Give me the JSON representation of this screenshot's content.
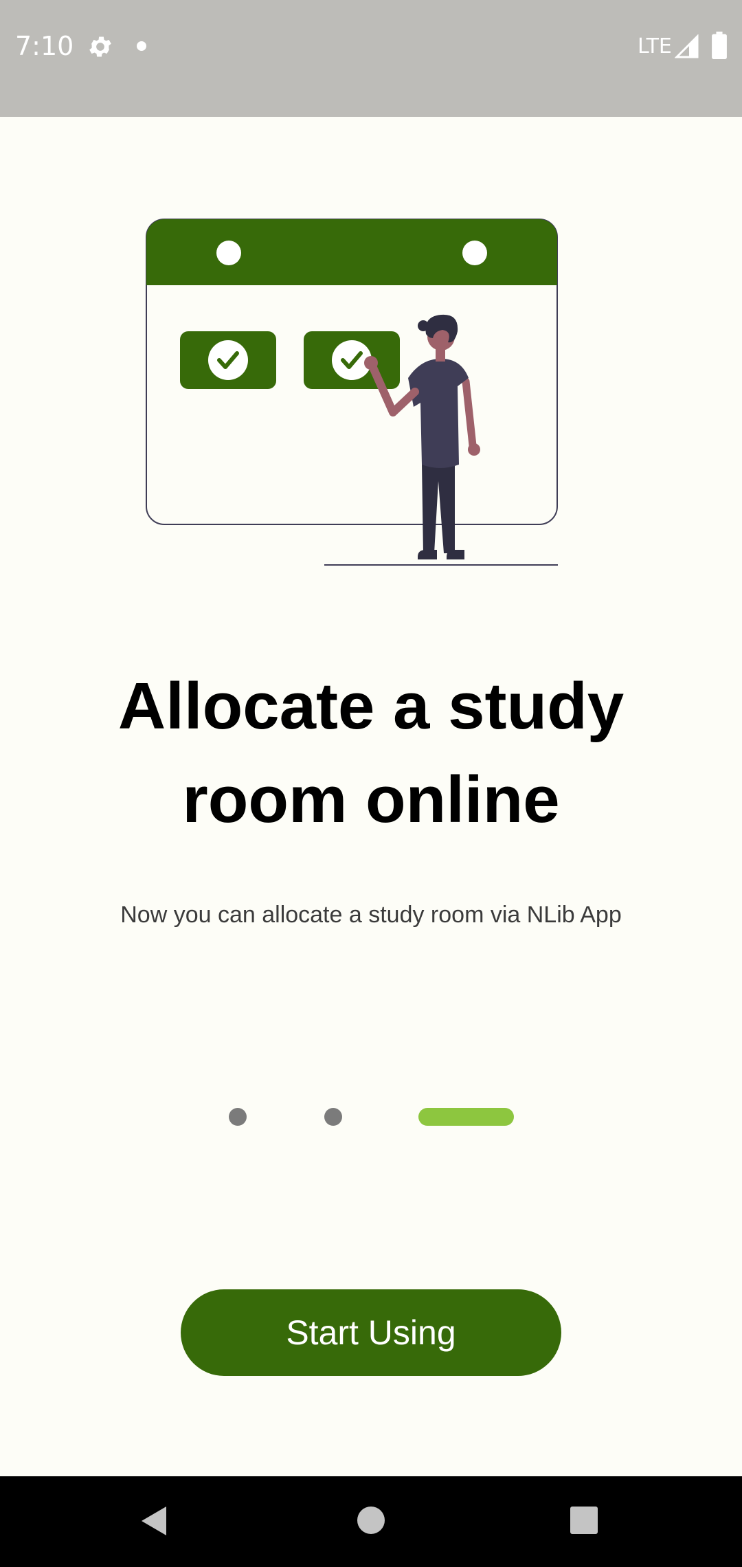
{
  "status_bar": {
    "time": "7:10",
    "network": "LTE",
    "icons": [
      "gear-icon",
      "notification-dot-icon",
      "signal-icon",
      "battery-icon"
    ]
  },
  "onboarding": {
    "illustration": "calendar-booking-illustration",
    "title": "Allocate a study room online",
    "subtitle": "Now you can allocate a study room via NLib App",
    "pager": {
      "total_pages": 3,
      "current_page": 3
    },
    "start_button_label": "Start Using"
  },
  "nav_bar": {
    "icons": [
      "back-icon",
      "home-icon",
      "recents-icon"
    ]
  },
  "colors": {
    "brand_green": "#376a09",
    "active_indicator": "#8dc63f",
    "inactive_indicator": "#7b7b7b",
    "background": "#fdfdf7"
  }
}
